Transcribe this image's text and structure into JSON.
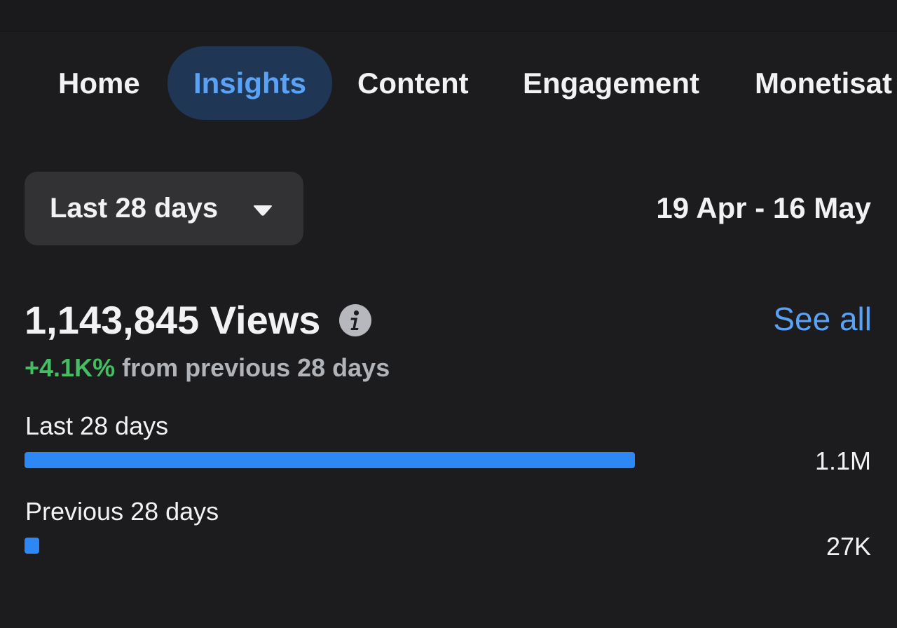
{
  "nav": {
    "tabs": [
      {
        "label": "Home",
        "active": false
      },
      {
        "label": "Insights",
        "active": true
      },
      {
        "label": "Content",
        "active": false
      },
      {
        "label": "Engagement",
        "active": false
      },
      {
        "label": "Monetisat",
        "active": false
      }
    ]
  },
  "filter": {
    "range_label": "Last 28 days",
    "date_range": "19 Apr - 16 May"
  },
  "views": {
    "count_text": "1,143,845 Views",
    "see_all": "See all",
    "change_pct": "+4.1K%",
    "change_text": "from previous 28 days"
  },
  "comparison": [
    {
      "label": "Last 28 days",
      "value_text": "1.1M",
      "value": 1143845
    },
    {
      "label": "Previous 28 days",
      "value_text": "27K",
      "value": 27000
    }
  ],
  "colors": {
    "background": "#1c1c1e",
    "accent": "#2d88f5",
    "link": "#5aa2f5",
    "positive": "#45bd62",
    "active_tab_bg": "#1f3655"
  },
  "icons": {
    "dropdown": "caret-down-icon",
    "info": "info-icon"
  }
}
